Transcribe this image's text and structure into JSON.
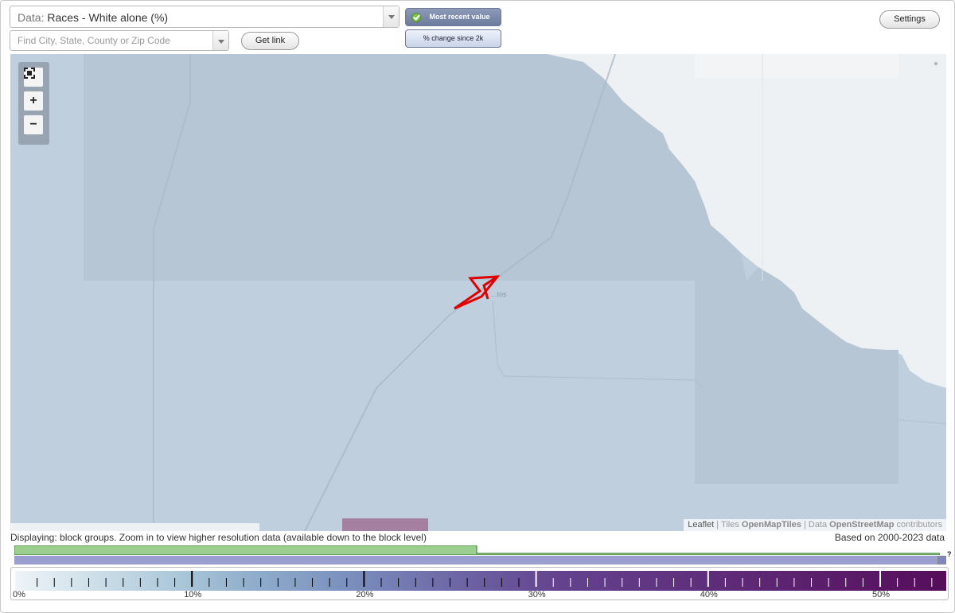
{
  "data_select": {
    "prefix": "Data:",
    "value": "Races - White alone (%)"
  },
  "search": {
    "placeholder": "Find City, State, County or Zip Code"
  },
  "buttons": {
    "get_link": "Get link",
    "settings": "Settings"
  },
  "toggles": {
    "most_recent": "Most recent value",
    "pct_change": "% change since 2k",
    "selected": "most_recent"
  },
  "map": {
    "place_label": "...tos",
    "attribution": {
      "leaflet": "Leaflet",
      "sep": " | ",
      "tiles_prefix": "Tiles ",
      "tiles": "OpenMapTiles",
      "data_prefix": "Data ",
      "data": "OpenStreetMap",
      "contributors": " contributors"
    },
    "colors": {
      "base": "#bfcfdd",
      "darker_block": "#b6c6d4",
      "water": "#eef1f4",
      "highlight": "#a47fa0",
      "marker": "#e00000"
    }
  },
  "zoom": {
    "zoom_in": "+",
    "zoom_out": "−"
  },
  "footer": {
    "displaying": "Displaying: block groups. Zoom in to view higher resolution data (available down to the block level)",
    "based_on": "Based on 2000-2023 data",
    "help": "?"
  },
  "legend": {
    "min": 0,
    "max": 55,
    "major_step": 10,
    "minor_step": 1,
    "ticks": [
      "0%",
      "10%",
      "20%",
      "30%",
      "40%",
      "50%"
    ],
    "colors": {
      "green": "#9ccf8f",
      "purple": "#9a9fd0"
    }
  }
}
